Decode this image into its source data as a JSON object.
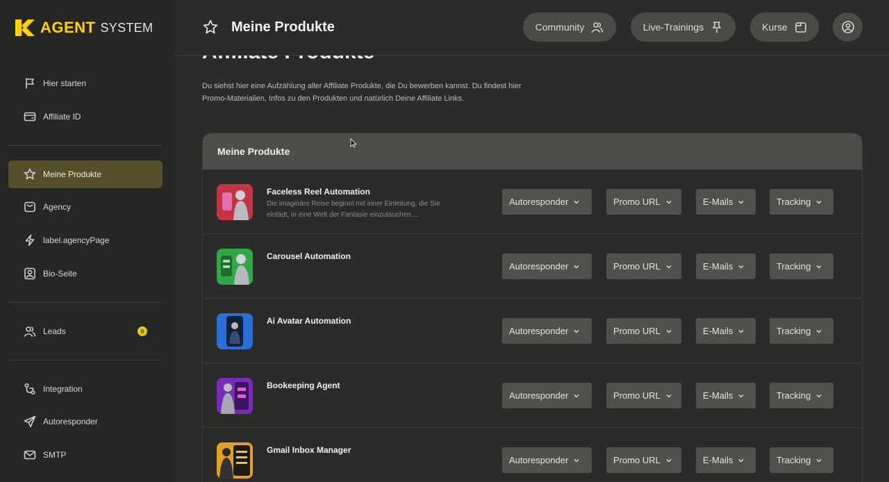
{
  "brand": {
    "logo_agent": "AGENT",
    "logo_system": "SYSTEM",
    "accent": "#ffd400"
  },
  "sidebar": {
    "items": [
      {
        "label": "Hier starten",
        "icon": "flag-icon"
      },
      {
        "label": "Affiliate ID",
        "icon": "card-icon"
      },
      {
        "label": "Meine Produkte",
        "icon": "star-icon",
        "active": true
      },
      {
        "label": "Agency",
        "icon": "bag-icon"
      },
      {
        "label": "label.agencyPage",
        "icon": "bolt-icon"
      },
      {
        "label": "Bio-Seite",
        "icon": "profile-icon"
      },
      {
        "label": "Leads",
        "icon": "users-icon",
        "badge": "0"
      },
      {
        "label": "Integration",
        "icon": "integration-icon"
      },
      {
        "label": "Autoresponder",
        "icon": "send-icon"
      },
      {
        "label": "SMTP",
        "icon": "mail-icon"
      }
    ]
  },
  "header": {
    "title": "Meine Produkte",
    "buttons": [
      {
        "label": "Community",
        "icon": "users-icon"
      },
      {
        "label": "Live-Trainings",
        "icon": "pin-icon"
      },
      {
        "label": "Kurse",
        "icon": "folder-icon"
      }
    ]
  },
  "main": {
    "section_heading": "Affiliate Produkte",
    "intro": "Du siehst hier eine Aufzählung aller Affiliate Produkte, die Du bewerben kannst. Du findest hier Promo-Materialien, Infos zu den Produkten und natürlich Deine Affiliate Links.",
    "card_title": "Meine Produkte",
    "dropdowns": [
      "Autoresponder",
      "Promo URL",
      "E-Mails",
      "Tracking"
    ],
    "products": [
      {
        "name": "Faceless Reel Automation",
        "desc": "Die imaginäre Reise beginnt mit einer Einleitung, die Sie einlädt, in eine Welt der Fantasie einzutauchen....",
        "thumb_color": "#c8323c"
      },
      {
        "name": "Carousel Automation",
        "desc": "",
        "thumb_color": "#35b84d"
      },
      {
        "name": "Ai Avatar Automation",
        "desc": "",
        "thumb_color": "#2a73d9"
      },
      {
        "name": "Bookeeping Agent",
        "desc": "",
        "thumb_color": "#8a2fc2"
      },
      {
        "name": "Gmail Inbox Manager",
        "desc": "",
        "thumb_color": "#e0a220"
      }
    ]
  }
}
